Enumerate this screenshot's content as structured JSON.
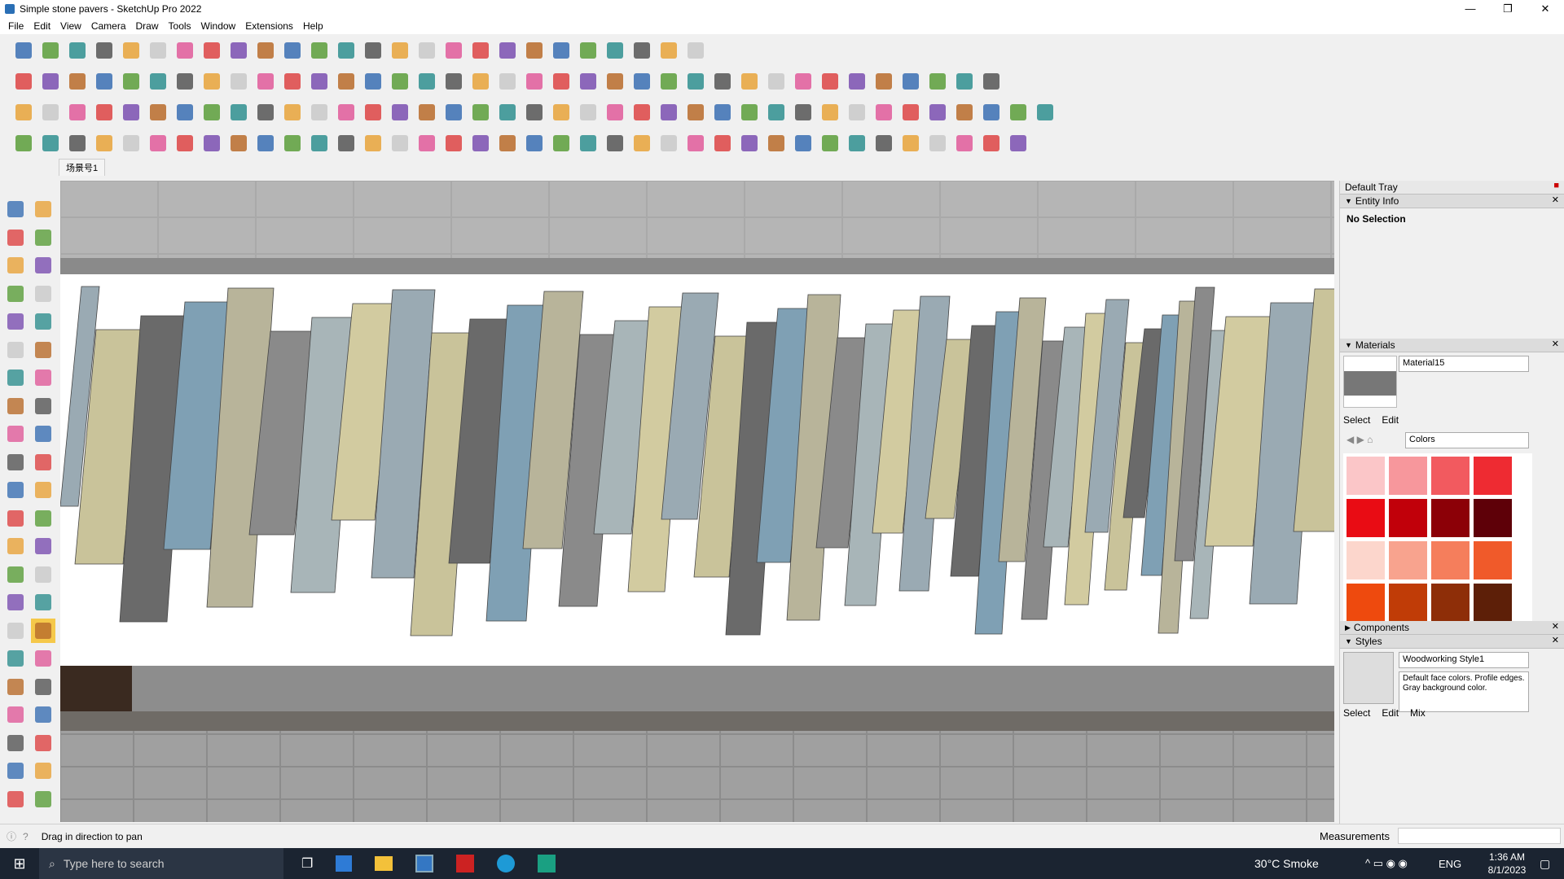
{
  "window": {
    "title": "Simple stone pavers - SketchUp Pro 2022",
    "controls": [
      "—",
      "❐",
      "✕"
    ]
  },
  "menu": [
    "File",
    "Edit",
    "View",
    "Camera",
    "Draw",
    "Tools",
    "Window",
    "Extensions",
    "Help"
  ],
  "scene_tab": "场景号1",
  "tray": {
    "title": "Default Tray",
    "entity_info": {
      "label": "Entity Info",
      "value": "No Selection"
    },
    "materials": {
      "label": "Materials",
      "name": "Material15",
      "tabs": [
        "Select",
        "Edit"
      ],
      "collection": "Colors",
      "swatches": [
        "#fbc6c8",
        "#f7979c",
        "#f25a5f",
        "#ee2b32",
        "#e90c14",
        "#c1000a",
        "#8c0007",
        "#5e0008",
        "#fcd6cc",
        "#f8a38e",
        "#f57e5c",
        "#f05a2a",
        "#ee4a0e",
        "#c03c07",
        "#8e2e08",
        "#5d1f08",
        "#fde3cc",
        "#fbc68e",
        "#f9a95a",
        "#f69021",
        "#f28e12",
        "#c76e0d",
        "#935209",
        "#603606"
      ]
    },
    "components": {
      "label": "Components"
    },
    "styles": {
      "label": "Styles",
      "name": "Woodworking Style1",
      "description": "Default face colors. Profile edges. Gray background color.",
      "tabs": [
        "Select",
        "Edit",
        "Mix"
      ]
    }
  },
  "status": {
    "hint": "Drag in direction to pan",
    "measurements": "Measurements"
  },
  "taskbar": {
    "search_placeholder": "Type here to search",
    "weather": "30°C  Smoke",
    "lang": "ENG",
    "time": "1:36 AM",
    "date": "8/1/2023"
  },
  "colors": {
    "accent": "#f5c84a",
    "tray_header": "#dcdcdc",
    "taskbar": "#1b2431"
  }
}
